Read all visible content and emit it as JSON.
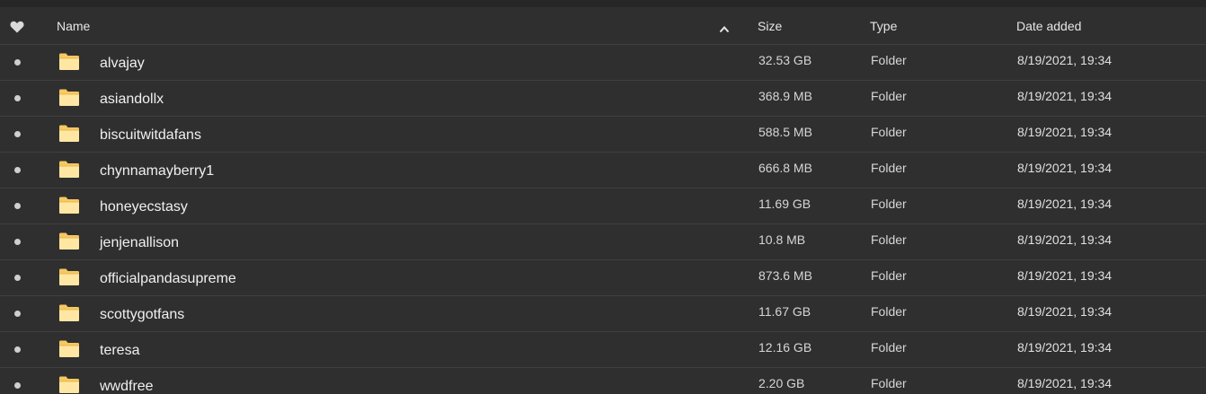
{
  "header": {
    "favorite_icon": "heart-icon",
    "name_label": "Name",
    "sort_icon": "chevron-up-icon",
    "size_label": "Size",
    "type_label": "Type",
    "date_label": "Date added"
  },
  "colors": {
    "background": "#2f2f2f",
    "divider": "#404040",
    "folder": "#f5c862",
    "folder_light": "#ffe7a3",
    "text": "#f0f0f0"
  },
  "rows": [
    {
      "name": "alvajay",
      "size": "32.53 GB",
      "type": "Folder",
      "date": "8/19/2021, 19:34"
    },
    {
      "name": "asiandollx",
      "size": "368.9 MB",
      "type": "Folder",
      "date": "8/19/2021, 19:34"
    },
    {
      "name": "biscuitwitdafans",
      "size": "588.5 MB",
      "type": "Folder",
      "date": "8/19/2021, 19:34"
    },
    {
      "name": "chynnamayberry1",
      "size": "666.8 MB",
      "type": "Folder",
      "date": "8/19/2021, 19:34"
    },
    {
      "name": "honeyecstasy",
      "size": "11.69 GB",
      "type": "Folder",
      "date": "8/19/2021, 19:34"
    },
    {
      "name": "jenjenallison",
      "size": "10.8 MB",
      "type": "Folder",
      "date": "8/19/2021, 19:34"
    },
    {
      "name": "officialpandasupreme",
      "size": "873.6 MB",
      "type": "Folder",
      "date": "8/19/2021, 19:34"
    },
    {
      "name": "scottygotfans",
      "size": "11.67 GB",
      "type": "Folder",
      "date": "8/19/2021, 19:34"
    },
    {
      "name": "teresa",
      "size": "12.16 GB",
      "type": "Folder",
      "date": "8/19/2021, 19:34"
    },
    {
      "name": "wwdfree",
      "size": "2.20 GB",
      "type": "Folder",
      "date": "8/19/2021, 19:34"
    }
  ]
}
